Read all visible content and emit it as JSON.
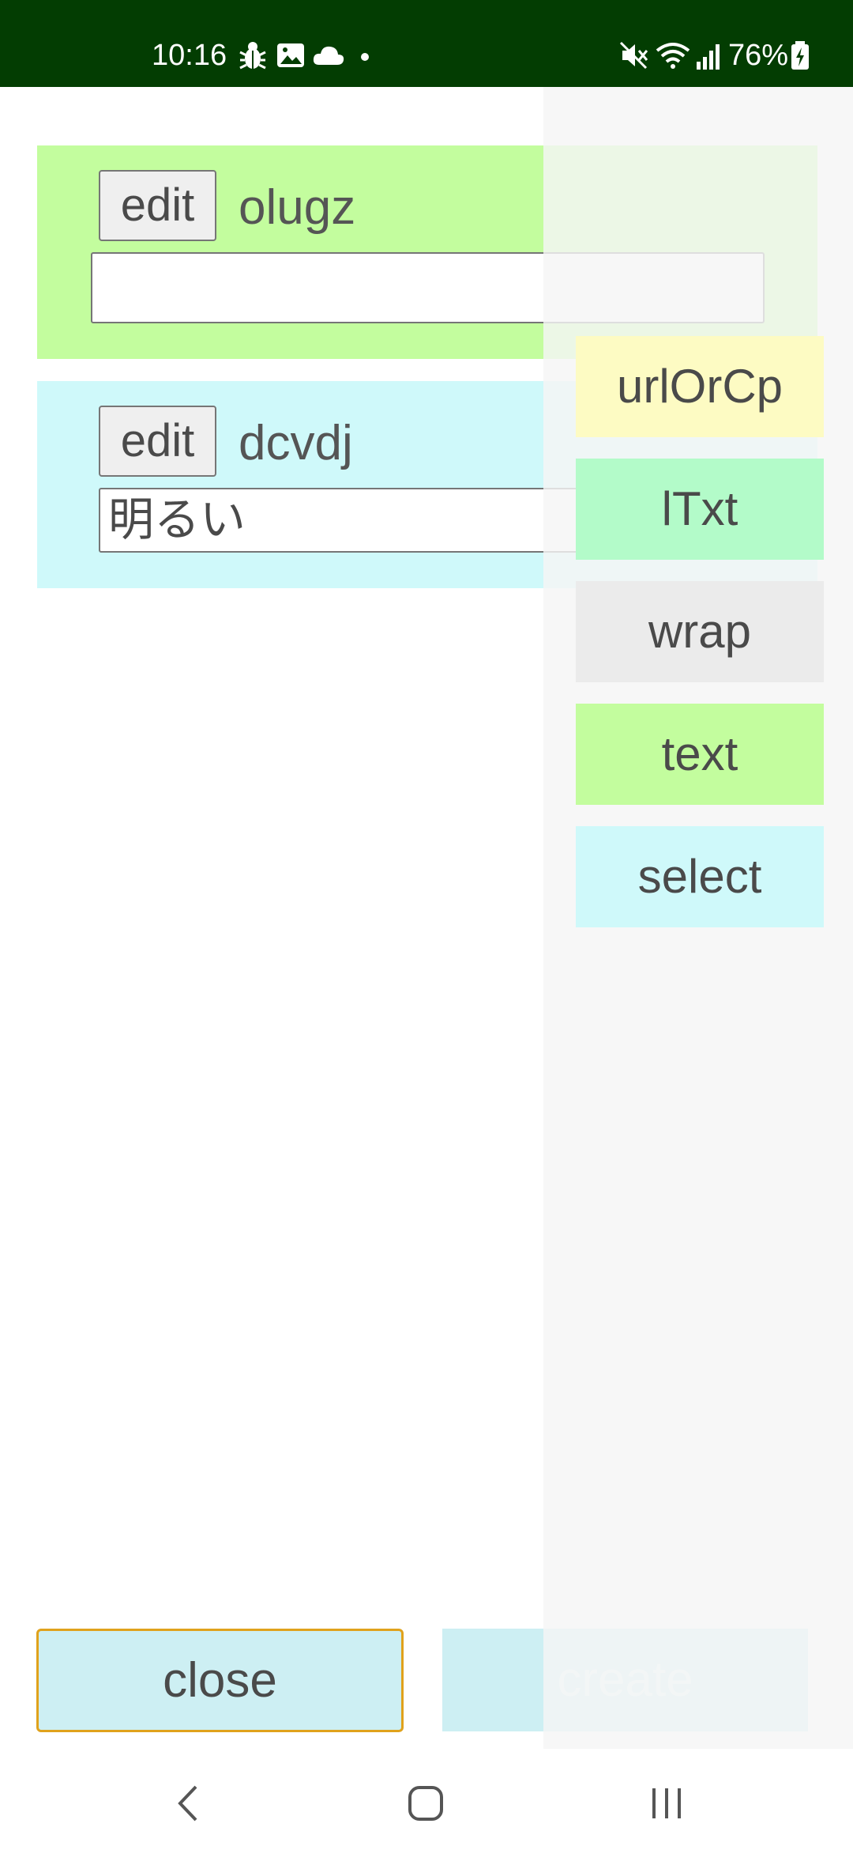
{
  "status_bar": {
    "time": "10:16",
    "battery": "76%",
    "icons": [
      "bug-icon",
      "image-icon",
      "cloud-icon",
      "dot-icon",
      "mute-icon",
      "wifi-icon",
      "signal-icon",
      "battery-charging-icon"
    ]
  },
  "cards": [
    {
      "edit_label": "edit",
      "title": "olugz",
      "input_value": ""
    },
    {
      "edit_label": "edit",
      "title": "dcvdj",
      "input_value": "明るい"
    }
  ],
  "menu": {
    "items": [
      {
        "label": "urlOrCp",
        "color": "#fdfbc3"
      },
      {
        "label": "lTxt",
        "color": "#b3fbc9"
      },
      {
        "label": "wrap",
        "color": "#ebebeb"
      },
      {
        "label": "text",
        "color": "#c3fd9e"
      },
      {
        "label": "select",
        "color": "#cff9fa"
      }
    ]
  },
  "actions": {
    "close_label": "close",
    "create_label": "create"
  },
  "colors": {
    "status_bar": "#033d02",
    "accent_border": "#e0a21c"
  },
  "nav_bar": {
    "icons": [
      "back-icon",
      "home-icon",
      "recents-icon"
    ]
  }
}
